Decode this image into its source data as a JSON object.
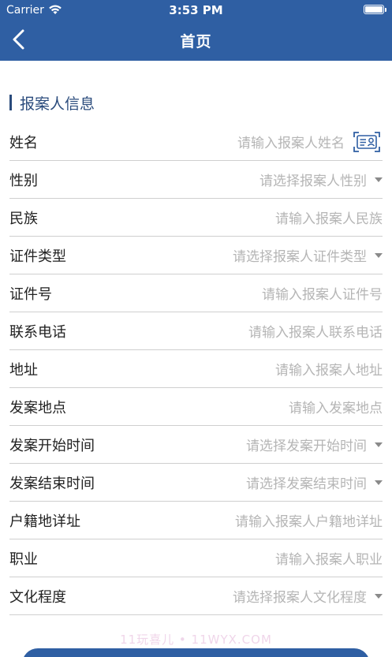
{
  "status": {
    "carrier": "Carrier",
    "time": "3:53 PM"
  },
  "nav": {
    "title": "首页",
    "back_icon": "chevron-left-icon"
  },
  "section": {
    "title": "报案人信息"
  },
  "fields": [
    {
      "label": "姓名",
      "placeholder": "请输入报案人姓名",
      "type": "input",
      "icon": "id-card-scan-icon"
    },
    {
      "label": "性别",
      "placeholder": "请选择报案人性别",
      "type": "select"
    },
    {
      "label": "民族",
      "placeholder": "请输入报案人民族",
      "type": "input"
    },
    {
      "label": "证件类型",
      "placeholder": "请选择报案人证件类型",
      "type": "select"
    },
    {
      "label": "证件号",
      "placeholder": "请输入报案人证件号",
      "type": "input"
    },
    {
      "label": "联系电话",
      "placeholder": "请输入报案人联系电话",
      "type": "input"
    },
    {
      "label": "地址",
      "placeholder": "请输入报案人地址",
      "type": "input"
    },
    {
      "label": "发案地点",
      "placeholder": "请输入发案地点",
      "type": "input"
    },
    {
      "label": "发案开始时间",
      "placeholder": "请选择发案开始时间",
      "type": "select"
    },
    {
      "label": "发案结束时间",
      "placeholder": "请选择发案结束时间",
      "type": "select"
    },
    {
      "label": "户籍地详址",
      "placeholder": "请输入报案人户籍地详址",
      "type": "input"
    },
    {
      "label": "职业",
      "placeholder": "请输入报案人职业",
      "type": "input"
    },
    {
      "label": "文化程度",
      "placeholder": "请选择报案人文化程度",
      "type": "select"
    }
  ],
  "watermark": "11玩喜儿 • 11WYX.COM",
  "colors": {
    "primary": "#2f5fa3",
    "section": "#2a4b7c",
    "placeholder": "#b5b5b5",
    "divider": "#cfcfcf"
  }
}
